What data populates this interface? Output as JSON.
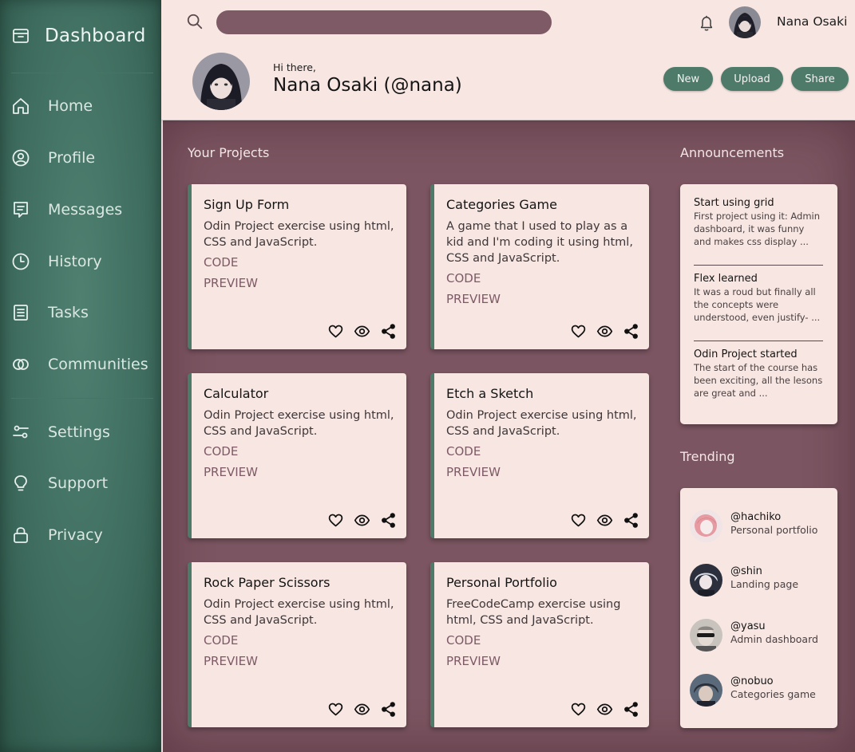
{
  "sidebar": {
    "brand": "Dashboard",
    "items": [
      {
        "label": "Home",
        "icon": "home-icon"
      },
      {
        "label": "Profile",
        "icon": "profile-icon"
      },
      {
        "label": "Messages",
        "icon": "messages-icon"
      },
      {
        "label": "History",
        "icon": "history-icon"
      },
      {
        "label": "Tasks",
        "icon": "tasks-icon"
      },
      {
        "label": "Communities",
        "icon": "communities-icon"
      },
      {
        "label": "Settings",
        "icon": "settings-icon"
      },
      {
        "label": "Support",
        "icon": "support-icon"
      },
      {
        "label": "Privacy",
        "icon": "lock-icon"
      }
    ]
  },
  "header": {
    "search_placeholder": "",
    "user_name": "Nana Osaki",
    "greeting": "Hi there,",
    "full_name": "Nana Osaki (@nana)",
    "buttons": {
      "new": "New",
      "upload": "Upload",
      "share": "Share"
    }
  },
  "projects": {
    "title": "Your Projects",
    "cards": [
      {
        "title": "Sign Up Form",
        "desc": "Odin Project exercise using html, CSS and JavaScript.",
        "code": "CODE",
        "preview": "PREVIEW"
      },
      {
        "title": "Categories Game",
        "desc": "A game that I used to play as a kid and I'm coding it using html, CSS and JavaScript.",
        "code": "CODE",
        "preview": "PREVIEW"
      },
      {
        "title": "Calculator",
        "desc": "Odin Project exercise using html, CSS and JavaScript.",
        "code": "CODE",
        "preview": "PREVIEW"
      },
      {
        "title": "Etch a Sketch",
        "desc": "Odin Project exercise using html, CSS and JavaScript.",
        "code": "CODE",
        "preview": "PREVIEW"
      },
      {
        "title": "Rock Paper Scissors",
        "desc": "Odin Project exercise using html, CSS and JavaScript.",
        "code": "CODE",
        "preview": "PREVIEW"
      },
      {
        "title": "Personal Portfolio",
        "desc": "FreeCodeCamp exercise using html, CSS and JavaScript.",
        "code": "CODE",
        "preview": "PREVIEW"
      }
    ]
  },
  "announcements": {
    "title": "Announcements",
    "items": [
      {
        "title": "Start using grid",
        "body": "First project using it: Admin dashboard, it was funny and makes css display ..."
      },
      {
        "title": "Flex learned",
        "body": "It was a roud but finally all the concepts were understood, even justify- ..."
      },
      {
        "title": "Odin Project started",
        "body": "The start of the course has been exciting, all the lesons are great and ..."
      }
    ]
  },
  "trending": {
    "title": "Trending",
    "items": [
      {
        "handle": "@hachiko",
        "sub": "Personal portfolio"
      },
      {
        "handle": "@shin",
        "sub": "Landing page"
      },
      {
        "handle": "@yasu",
        "sub": "Admin dashboard"
      },
      {
        "handle": "@nobuo",
        "sub": "Categories game"
      }
    ]
  },
  "colors": {
    "sidebar": "#3f6e60",
    "main": "#7b5561",
    "card": "#f7e6e1",
    "accent": "#4e7a6a",
    "link": "#7d5a66"
  }
}
